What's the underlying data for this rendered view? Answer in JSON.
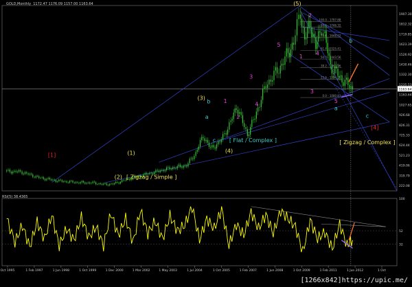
{
  "header": {
    "symbol": "GOLD,Monthly",
    "ohlc": "1172.47  1176.09  1157.00  1163.64"
  },
  "rsi_header": "RSI(5) 38.4365",
  "watermark": "[1266x842]https://upic.me/",
  "colors": {
    "background": "#000000",
    "candles": "#33cc33",
    "trendlines": "#3344cc",
    "fib_lines": "#606060",
    "rsi_line": "#ffff00",
    "wave_yellow": "#f2e24a",
    "wave_magenta": "#e040d0",
    "wave_cyan": "#33cccc",
    "wave_red": "#ee2222",
    "orange_arrow": "#ff7733",
    "violet_arrow": "#9a66ff"
  },
  "chart_data": [
    {
      "type": "candlestick",
      "title": "GOLD,Monthly",
      "price_axis_ticks": [
        "1907.30",
        "1812.32",
        "1719.85",
        "1623.39",
        "1526.92",
        "1430.46",
        "1332.30",
        "1235.53",
        "1163.64",
        "1027.65",
        "926.68",
        "826.31",
        "725.33",
        "624.44",
        "521.23",
        "419.06",
        "319.79",
        "222.08"
      ],
      "last_price": 1163.64,
      "ylim": [
        200,
        1950
      ],
      "x_ticks": [
        "Oct 1995",
        "1 Feb 1997",
        "1 Jun 1998",
        "1 Oct 1999",
        "1 Dec 2000",
        "1 Mar 2002",
        "1 May 2003",
        "1 Jul 2004",
        "1 Oct 2005",
        "1 Feb 2007",
        "1 Jun 2008",
        "1 Oct 2009",
        "1 Feb 2011",
        "1 Jun 2012",
        "1 Oct"
      ],
      "series": [
        {
          "x": [
            1995.75,
            1996.5,
            1997.5,
            1998.5,
            1999.5,
            2000.5,
            2001.0,
            2001.5,
            2002.5,
            2003.5,
            2004.5,
            2005.5,
            2006.0,
            2006.4,
            2006.8,
            2007.3,
            2007.9,
            2008.2,
            2008.8,
            2009.2,
            2009.8,
            2010.5,
            2011.0,
            2011.3,
            2011.67,
            2011.9,
            2012.2,
            2012.5,
            2012.8,
            2013.0,
            2013.3,
            2013.7,
            2014.0,
            2014.5
          ],
          "values": [
            385,
            380,
            325,
            295,
            280,
            275,
            260,
            265,
            320,
            365,
            410,
            440,
            560,
            720,
            600,
            660,
            850,
            1000,
            730,
            900,
            1200,
            1350,
            1500,
            1600,
            1900,
            1620,
            1790,
            1550,
            1760,
            1650,
            1380,
            1300,
            1240,
            1164
          ]
        }
      ],
      "fib_levels": [
        {
          "label": "100.0 - 1797.88",
          "value": 1797.88
        },
        {
          "label": "88.6 - 1746.32",
          "value": 1746.32
        },
        {
          "label": "78.6 - 1648.62",
          "value": 1648.62
        },
        {
          "label": "61.8 - 1525.41",
          "value": 1525.41
        },
        {
          "label": "50.0 - 1443.56",
          "value": 1443.56
        },
        {
          "label": "38.2 - 1363.96",
          "value": 1363.96
        },
        {
          "label": "23.6 - 1254.26",
          "value": 1254.26
        },
        {
          "label": "0.0 - 1080.81",
          "value": 1080.81
        }
      ],
      "wave_labels": [
        {
          "text": "[1]",
          "color": "wave_red",
          "x": 1998.2,
          "y": 520
        },
        {
          "text": "(1)",
          "color": "wave_yellow",
          "x": 2002.5,
          "y": 540
        },
        {
          "text": "(2)",
          "color": "wave_yellow",
          "x": 2001.8,
          "y": 315
        },
        {
          "text": "[ Zigzag / Simple ]",
          "color": "wave_yellow",
          "x": 2003.6,
          "y": 315
        },
        {
          "text": "(3)",
          "color": "wave_yellow",
          "x": 2006.3,
          "y": 1060
        },
        {
          "text": "b",
          "color": "wave_cyan",
          "x": 2006.7,
          "y": 1025
        },
        {
          "text": "a",
          "color": "wave_cyan",
          "x": 2006.6,
          "y": 880
        },
        {
          "text": "c",
          "color": "wave_cyan",
          "x": 2007.0,
          "y": 660
        },
        {
          "text": "(4)",
          "color": "wave_yellow",
          "x": 2007.8,
          "y": 560
        },
        {
          "text": "[ Flat / Complex ]",
          "color": "wave_cyan",
          "x": 2009.1,
          "y": 660
        },
        {
          "text": "1",
          "color": "wave_magenta",
          "x": 2007.6,
          "y": 1030
        },
        {
          "text": "2",
          "color": "wave_magenta",
          "x": 2008.3,
          "y": 880
        },
        {
          "text": "3",
          "color": "wave_magenta",
          "x": 2009.0,
          "y": 1260
        },
        {
          "text": "4",
          "color": "wave_magenta",
          "x": 2009.3,
          "y": 1000
        },
        {
          "text": "5",
          "color": "wave_magenta",
          "x": 2010.5,
          "y": 1560
        },
        {
          "text": "(5)",
          "color": "wave_yellow",
          "x": 2011.5,
          "y": 1950
        },
        {
          "text": "2",
          "color": "wave_magenta",
          "x": 2012.2,
          "y": 1840
        },
        {
          "text": "1",
          "color": "wave_magenta",
          "x": 2011.7,
          "y": 1450
        },
        {
          "text": "4",
          "color": "wave_magenta",
          "x": 2012.6,
          "y": 1480
        },
        {
          "text": "3",
          "color": "wave_magenta",
          "x": 2012.3,
          "y": 1120
        },
        {
          "text": "5",
          "color": "wave_magenta",
          "x": 2013.6,
          "y": 1030
        },
        {
          "text": "a",
          "color": "wave_cyan",
          "x": 2013.6,
          "y": 960
        },
        {
          "text": "b",
          "color": "wave_cyan",
          "x": 2014.4,
          "y": 1600
        },
        {
          "text": "c",
          "color": "wave_cyan",
          "x": 2015.3,
          "y": 890
        },
        {
          "text": "[4]",
          "color": "wave_red",
          "x": 2015.7,
          "y": 780
        },
        {
          "text": "[ Zigzag / Complex ]",
          "color": "wave_yellow",
          "x": 2015.3,
          "y": 640
        }
      ]
    },
    {
      "type": "line",
      "title": "RSI(5) 38.4365",
      "ylim": [
        0,
        100
      ],
      "y_ticks": [
        "100",
        "52",
        "32"
      ],
      "series": [
        {
          "name": "RSI(5)",
          "x": [
            1995.75,
            1996.2,
            1996.6,
            1997.0,
            1997.4,
            1997.8,
            1998.2,
            1998.6,
            1999.0,
            1999.4,
            1999.8,
            2000.2,
            2000.6,
            2001.0,
            2001.4,
            2001.8,
            2002.2,
            2002.6,
            2003.0,
            2003.4,
            2003.8,
            2004.2,
            2004.6,
            2005.0,
            2005.4,
            2005.8,
            2006.2,
            2006.6,
            2007.0,
            2007.4,
            2007.8,
            2008.2,
            2008.6,
            2009.0,
            2009.4,
            2009.8,
            2010.2,
            2010.6,
            2011.0,
            2011.4,
            2011.8,
            2012.2,
            2012.6,
            2013.0,
            2013.4,
            2013.8,
            2014.2,
            2014.5
          ],
          "values": [
            70,
            35,
            60,
            28,
            65,
            40,
            75,
            30,
            55,
            38,
            72,
            42,
            58,
            30,
            78,
            45,
            70,
            35,
            82,
            48,
            66,
            40,
            74,
            52,
            60,
            88,
            38,
            70,
            55,
            84,
            30,
            62,
            45,
            80,
            55,
            76,
            48,
            82,
            70,
            58,
            20,
            68,
            40,
            50,
            25,
            62,
            30,
            38
          ]
        }
      ]
    }
  ]
}
